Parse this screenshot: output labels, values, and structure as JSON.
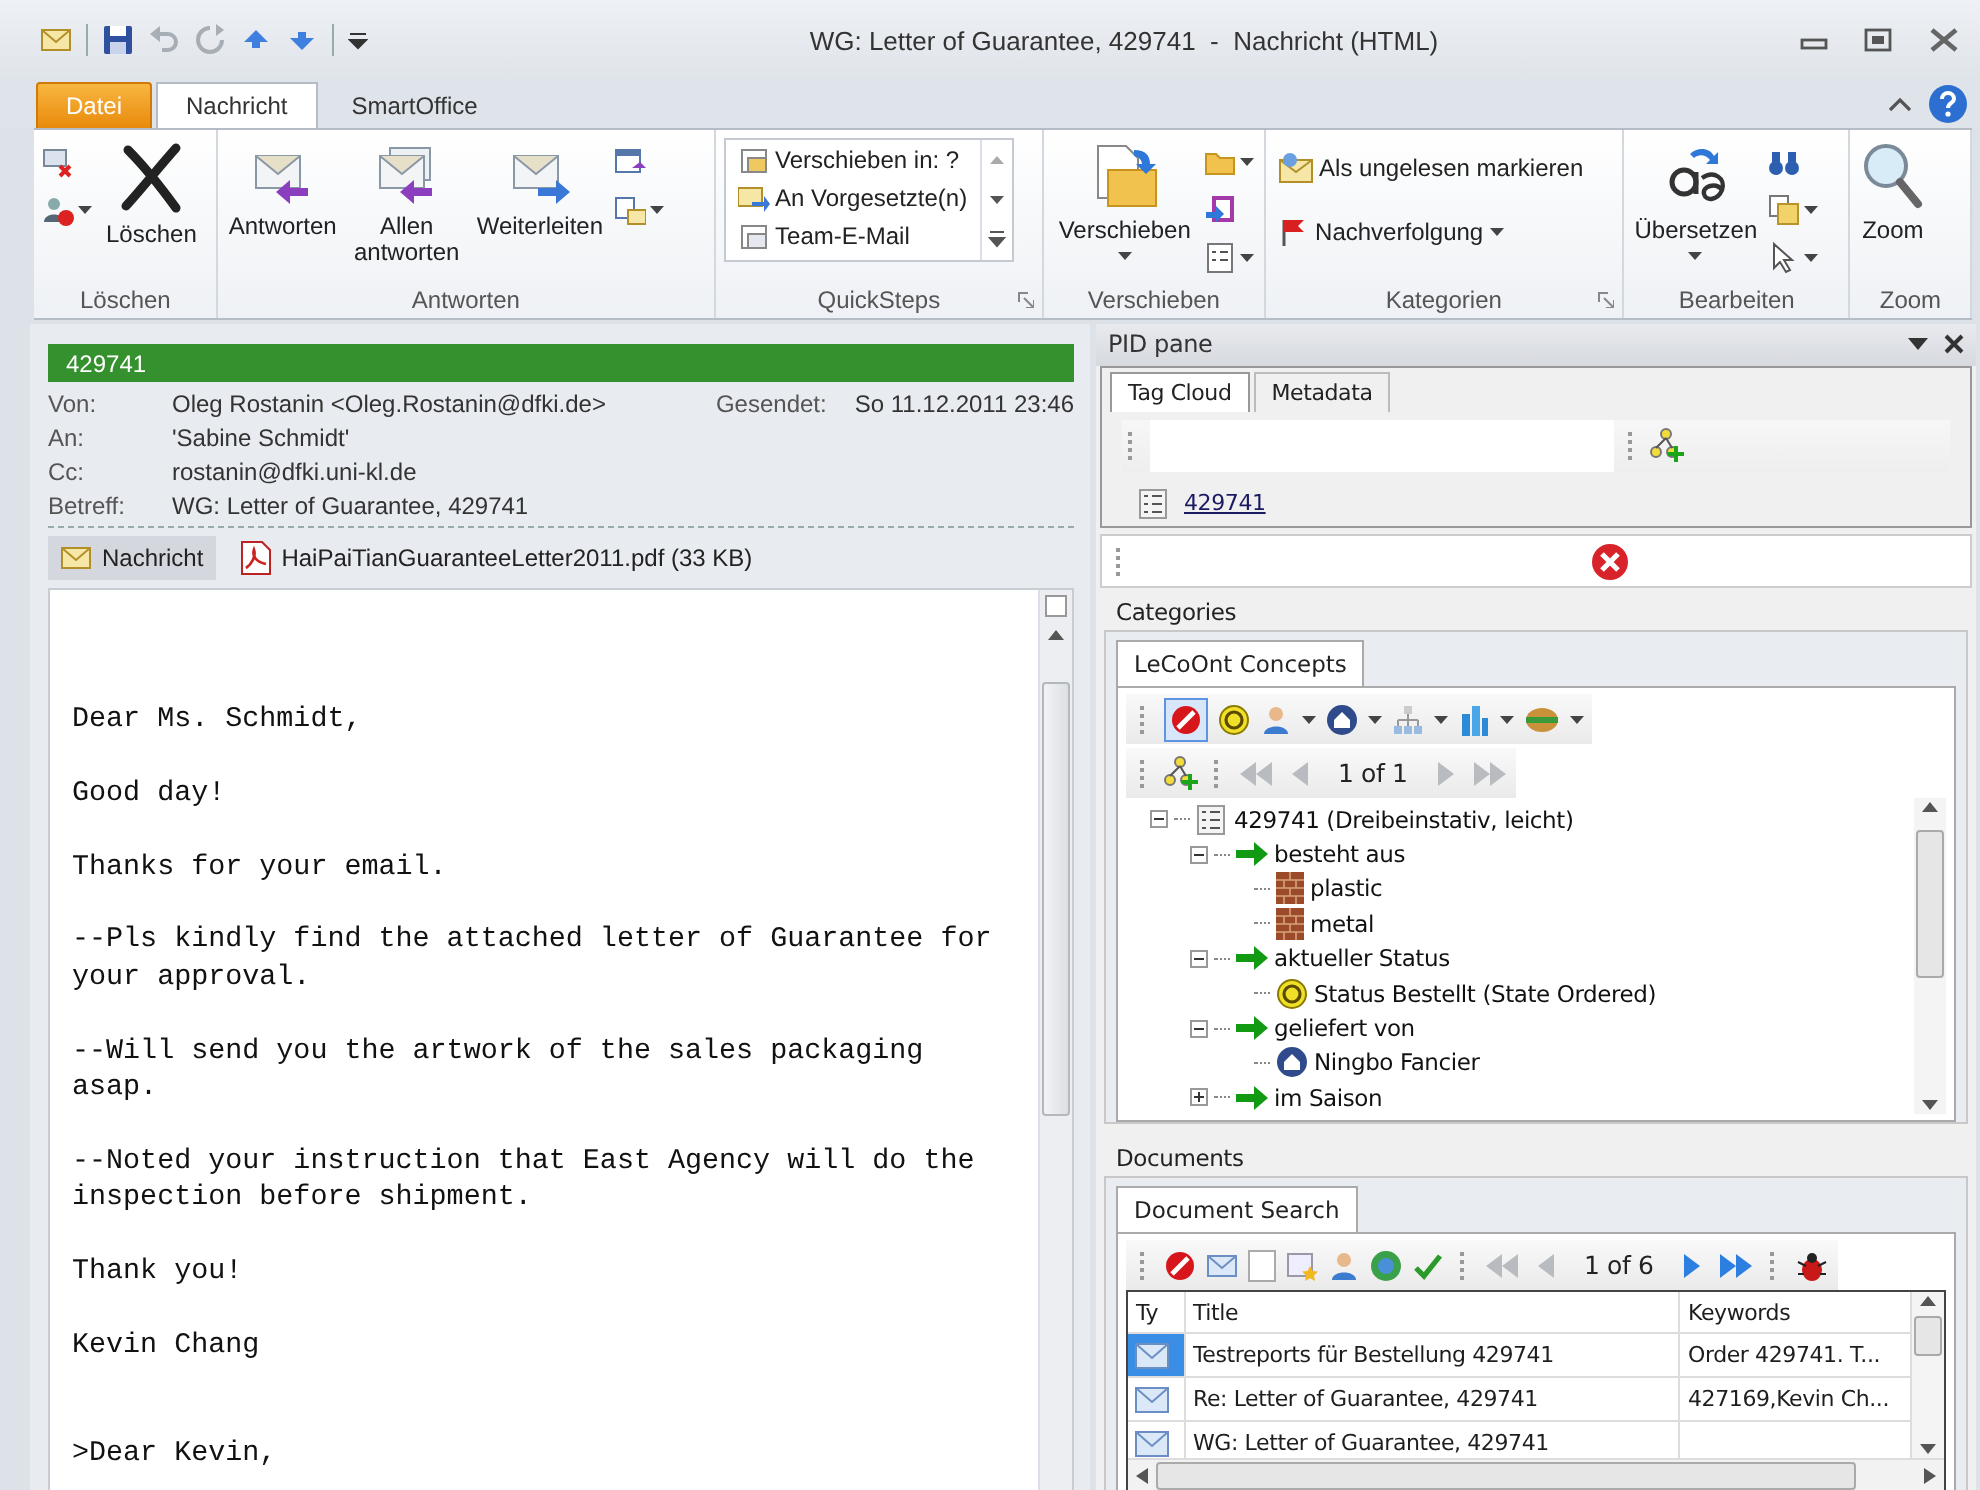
{
  "window": {
    "title": "WG: Letter of Guarantee, 429741  -  Nachricht (HTML)"
  },
  "ribbon_tabs": [
    {
      "label": "Datei",
      "kind": "file",
      "selected": false
    },
    {
      "label": "Nachricht",
      "kind": "tab",
      "selected": true
    },
    {
      "label": "SmartOffice",
      "kind": "tab",
      "selected": false
    }
  ],
  "ribbon": [
    {
      "label": "Löschen",
      "kind": "delete",
      "buttons": [
        {
          "label": "Löschen"
        }
      ]
    },
    {
      "label": "Antworten",
      "kind": "respond",
      "buttons": [
        {
          "label": "Antworten"
        },
        {
          "label": "Allen antworten"
        },
        {
          "label": "Weiterleiten"
        }
      ]
    },
    {
      "label": "QuickSteps",
      "kind": "quicksteps",
      "buttons": [
        {
          "label": "Verschieben in: ?"
        },
        {
          "label": "An Vorgesetzte(n)"
        },
        {
          "label": "Team-E-Mail"
        }
      ]
    },
    {
      "label": "Verschieben",
      "kind": "move",
      "buttons": [
        {
          "label": "Verschieben",
          "dropdown": true
        }
      ]
    },
    {
      "label": "Kategorien",
      "kind": "tags",
      "buttons": [
        {
          "label": "Als ungelesen markieren"
        },
        {
          "label": "Nachverfolgung",
          "dropdown": true
        }
      ]
    },
    {
      "label": "Bearbeiten",
      "kind": "editing",
      "buttons": [
        {
          "label": "Übersetzen",
          "dropdown": true
        }
      ]
    },
    {
      "label": "Zoom",
      "kind": "zoom",
      "buttons": [
        {
          "label": "Zoom"
        }
      ]
    }
  ],
  "message": {
    "category": {
      "label": "429741",
      "color": "#35912d"
    },
    "fields": [
      {
        "label": "Von:",
        "value": "Oleg Rostanin <Oleg.Rostanin@dfki.de>"
      },
      {
        "label": "An:",
        "value": "'Sabine Schmidt'"
      },
      {
        "label": "Cc:",
        "value": "rostanin@dfki.uni-kl.de"
      },
      {
        "label": "Betreff:",
        "value": "WG: Letter of Guarantee, 429741"
      }
    ],
    "sent": {
      "label": "Gesendet:",
      "value": "So 11.12.2011 23:46"
    },
    "views": [
      {
        "label": "Nachricht",
        "kind": "message",
        "selected": true
      },
      {
        "label": "HaiPaiTianGuaranteeLetter2011.pdf (33 KB)",
        "kind": "pdf",
        "selected": false
      }
    ],
    "body": [
      {
        "text": "Dear Ms. Schmidt,",
        "kind": "text"
      },
      {
        "text": "Good day!",
        "kind": "text"
      },
      {
        "text": "Thanks for your email.",
        "kind": "text"
      },
      {
        "text": "--Pls kindly find the attached letter of Guarantee for your approval.",
        "kind": "text"
      },
      {
        "text": "--Will send you the artwork of the sales packaging asap.",
        "kind": "text"
      },
      {
        "text": "--Noted your instruction that East Agency will do the inspection before shipment.",
        "kind": "text"
      },
      {
        "text": "Thank you!",
        "kind": "text"
      },
      {
        "text": "Kevin Chang",
        "kind": "text"
      },
      {
        "text": ">Dear Kevin,",
        "kind": "quote"
      }
    ]
  },
  "pid_pane": {
    "title": "PID pane",
    "tabs": [
      {
        "label": "Tag Cloud",
        "selected": true
      },
      {
        "label": "Metadata",
        "selected": false
      }
    ],
    "tags": [
      {
        "label": "429741"
      }
    ],
    "categories": {
      "title": "Categories",
      "tab": "LeCoOnt Concepts",
      "pager": "1 of 1",
      "tree": [
        {
          "label": "429741 (Dreibeinstativ, leicht)",
          "kind": "order",
          "expanded": true,
          "children": [
            {
              "label": "besteht aus",
              "kind": "relation",
              "expanded": true,
              "children": [
                {
                  "label": "plastic",
                  "kind": "material"
                },
                {
                  "label": "metal",
                  "kind": "material"
                }
              ]
            },
            {
              "label": "aktueller Status",
              "kind": "relation",
              "expanded": true,
              "children": [
                {
                  "label": "Status Bestellt (State Ordered)",
                  "kind": "status"
                }
              ]
            },
            {
              "label": "geliefert von",
              "kind": "relation",
              "expanded": true,
              "children": [
                {
                  "label": "Ningbo Fancier",
                  "kind": "place"
                }
              ]
            },
            {
              "label": "im Saison",
              "kind": "relation",
              "expanded": false
            }
          ]
        }
      ]
    },
    "documents": {
      "title": "Documents",
      "tab": "Document Search",
      "pager": "1 of 6",
      "columns": [
        "Ty",
        "Title",
        "Keywords"
      ],
      "rows": [
        {
          "title": "Testreports für Bestellung 429741",
          "keywords": "Order 429741. T...",
          "selected": true
        },
        {
          "title": "Re: Letter of Guarantee, 429741",
          "keywords": "427169,Kevin Ch...",
          "selected": false
        },
        {
          "title": "WG: Letter of Guarantee, 429741",
          "selected": false
        }
      ]
    }
  }
}
